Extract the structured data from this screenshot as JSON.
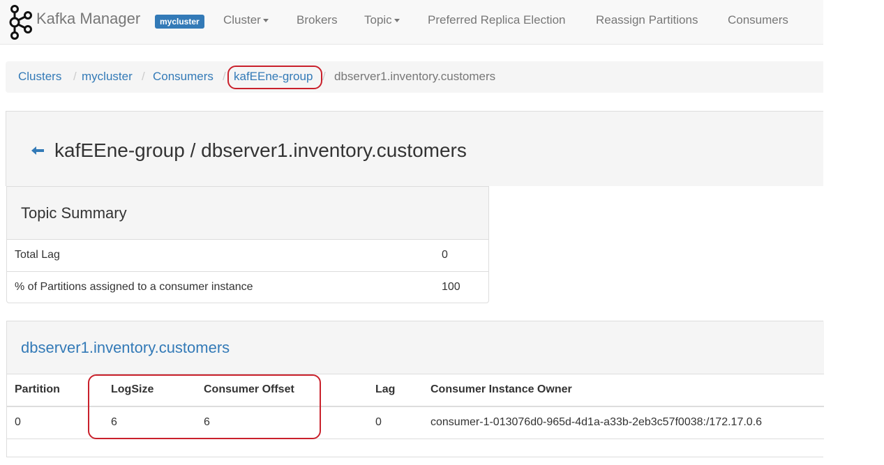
{
  "brand": {
    "name": "Kafka Manager",
    "cluster_badge": "mycluster"
  },
  "nav": {
    "items": [
      {
        "label": "Cluster",
        "dropdown": true
      },
      {
        "label": "Brokers",
        "dropdown": false
      },
      {
        "label": "Topic",
        "dropdown": true
      },
      {
        "label": "Preferred Replica Election",
        "dropdown": false
      },
      {
        "label": "Reassign Partitions",
        "dropdown": false
      },
      {
        "label": "Consumers",
        "dropdown": false
      }
    ]
  },
  "breadcrumb": {
    "items": [
      {
        "label": "Clusters",
        "active": false
      },
      {
        "label": "mycluster",
        "active": false
      },
      {
        "label": "Consumers",
        "active": false
      },
      {
        "label": "kafEEne-group",
        "active": false,
        "highlighted": true
      },
      {
        "label": "dbserver1.inventory.customers",
        "active": true
      }
    ],
    "separator": "/"
  },
  "page": {
    "title": "kafEEne-group / dbserver1.inventory.customers",
    "back_icon": "arrow-left-icon"
  },
  "topic_summary": {
    "title": "Topic Summary",
    "rows": [
      {
        "label": "Total Lag",
        "value": "0"
      },
      {
        "label": "% of Partitions assigned to a consumer instance",
        "value": "100"
      }
    ]
  },
  "partitions": {
    "title": "dbserver1.inventory.customers",
    "columns": [
      "Partition",
      "LogSize",
      "Consumer Offset",
      "Lag",
      "Consumer Instance Owner"
    ],
    "rows": [
      [
        "0",
        "6",
        "6",
        "0",
        "consumer-1-013076d0-965d-4d1a-a33b-2eb3c57f0038:/172.17.0.6"
      ]
    ]
  },
  "colors": {
    "link": "#337ab7",
    "badge": "#337ab7",
    "highlight": "#c9202b",
    "panel_bg": "#f5f5f5"
  }
}
